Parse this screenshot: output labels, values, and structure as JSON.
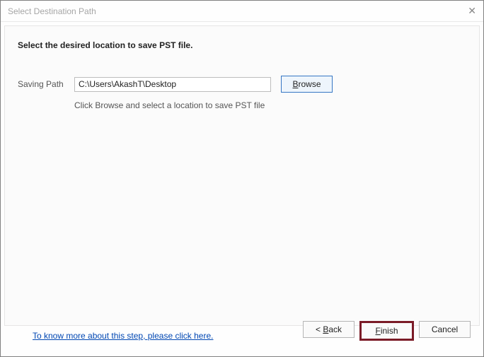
{
  "window": {
    "title": "Select Destination Path"
  },
  "heading": "Select the desired location to save PST file.",
  "path": {
    "label": "Saving Path",
    "value": "C:\\Users\\AkashT\\Desktop",
    "browse_prefix": "B",
    "browse_rest": "rowse"
  },
  "hint": "Click Browse and select a location to save PST file",
  "link_more": "To know more about this step, please click here.",
  "buttons": {
    "back_prefix": "< ",
    "back_u": "B",
    "back_rest": "ack",
    "finish_u": "F",
    "finish_rest": "inish",
    "cancel": "Cancel"
  }
}
